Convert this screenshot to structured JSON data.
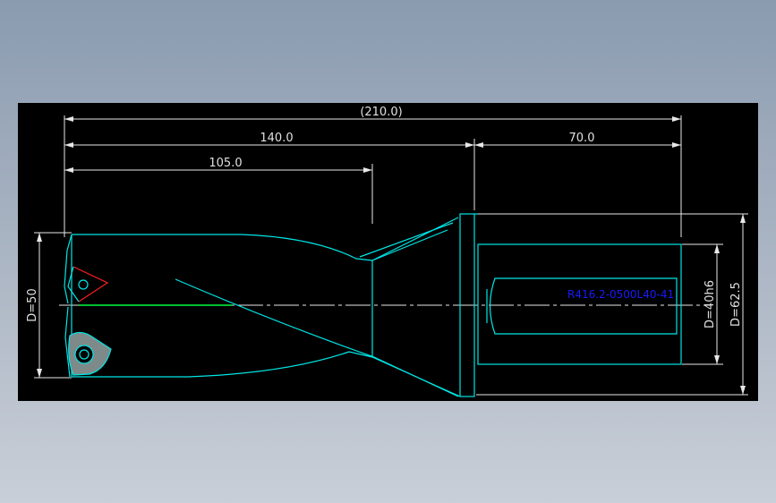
{
  "drawing": {
    "colors": {
      "background": "#000000",
      "outline": "#00e6e6",
      "dimension": "#e8e8e8",
      "centerline": "#e8e8e8",
      "cutting_edge": "#00ff40",
      "insert_edge": "#ff2020",
      "part_label": "#1a1aff"
    },
    "dimensions": {
      "overall_length": "(210.0)",
      "body_length": "140.0",
      "shank_length": "70.0",
      "drill_depth": "105.0",
      "drill_diameter": "D=50",
      "shank_diameter": "D=40h6",
      "flange_diameter": "D=62.5"
    },
    "part_number": "R416.2-0500L40-41"
  }
}
